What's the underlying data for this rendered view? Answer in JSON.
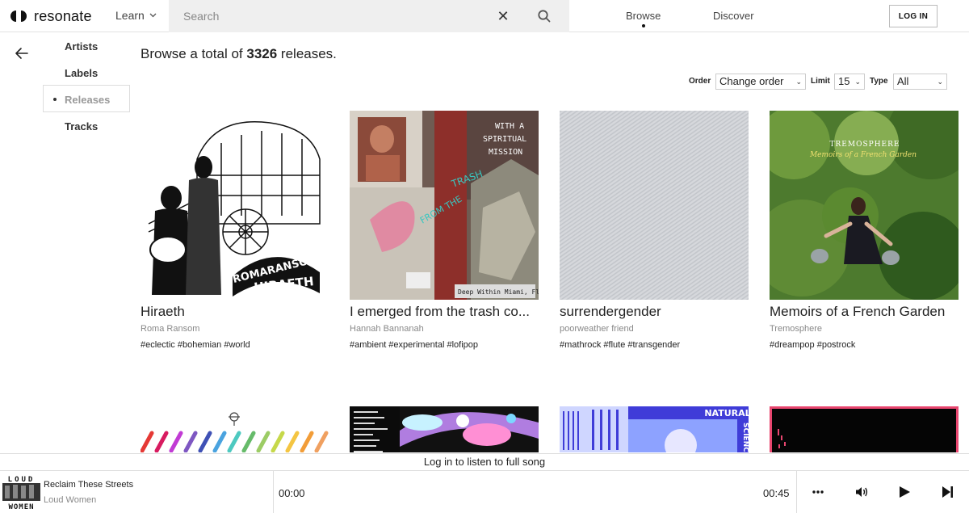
{
  "header": {
    "logo_text": "resonate",
    "learn_label": "Learn",
    "search_placeholder": "Search",
    "nav": {
      "browse": "Browse",
      "discover": "Discover"
    },
    "login_label": "LOG IN"
  },
  "sidebar": {
    "items": [
      {
        "label": "Artists"
      },
      {
        "label": "Labels"
      },
      {
        "label": "Releases",
        "active": true
      },
      {
        "label": "Tracks"
      }
    ]
  },
  "main": {
    "title_prefix": "Browse a total of",
    "total": "3326",
    "title_suffix": "releases.",
    "filters": {
      "order_label": "Order",
      "order_value": "Change order",
      "limit_label": "Limit",
      "limit_value": "15",
      "type_label": "Type",
      "type_value": "All"
    },
    "releases": [
      {
        "title": "Hiraeth",
        "artist": "Roma Ransom",
        "tags": "#eclectic #bohemian #world"
      },
      {
        "title": "I emerged from the trash co...",
        "artist": "Hannah Bannanah",
        "tags": "#ambient #experimental #lofipop"
      },
      {
        "title": "surrendergender",
        "artist": "poorweather friend",
        "tags": "#mathrock #flute #transgender"
      },
      {
        "title": "Memoirs of a French Garden",
        "artist": "Tremosphere",
        "tags": "#dreampop #postrock"
      }
    ],
    "cover_text": {
      "hiraeth_band": "ROMARANSOM",
      "hiraeth_title": "HIRAETH",
      "trash_1": "WITH A",
      "trash_2": "SPIRITUAL",
      "trash_3": "MISSION",
      "trash_4": "TRASH",
      "trash_5": "FROM THE",
      "trash_6": "Deep Within Miami, Fl",
      "memoirs_band": "TREMOSPHERE",
      "memoirs_title": "Memoirs of a French Garden",
      "natural_1": "NATURAL",
      "natural_2": "SCIENCE"
    }
  },
  "banner": {
    "text": "Log in to listen to full song"
  },
  "player": {
    "art_text_top": "LOUD",
    "art_text_bottom": "WOMEN",
    "track_title": "Reclaim These Streets",
    "track_artist": "Loud Women",
    "time_current": "00:00",
    "time_total": "00:45"
  },
  "icons": {
    "back": "arrow-left-icon",
    "clear": "close-icon",
    "search": "search-icon",
    "more": "more-dots-icon",
    "volume": "volume-icon",
    "play": "play-icon",
    "next": "skip-next-icon"
  },
  "colors": {
    "accent": "#111111",
    "muted": "#888888",
    "border": "#dddddd",
    "search_bg": "#efefef"
  }
}
